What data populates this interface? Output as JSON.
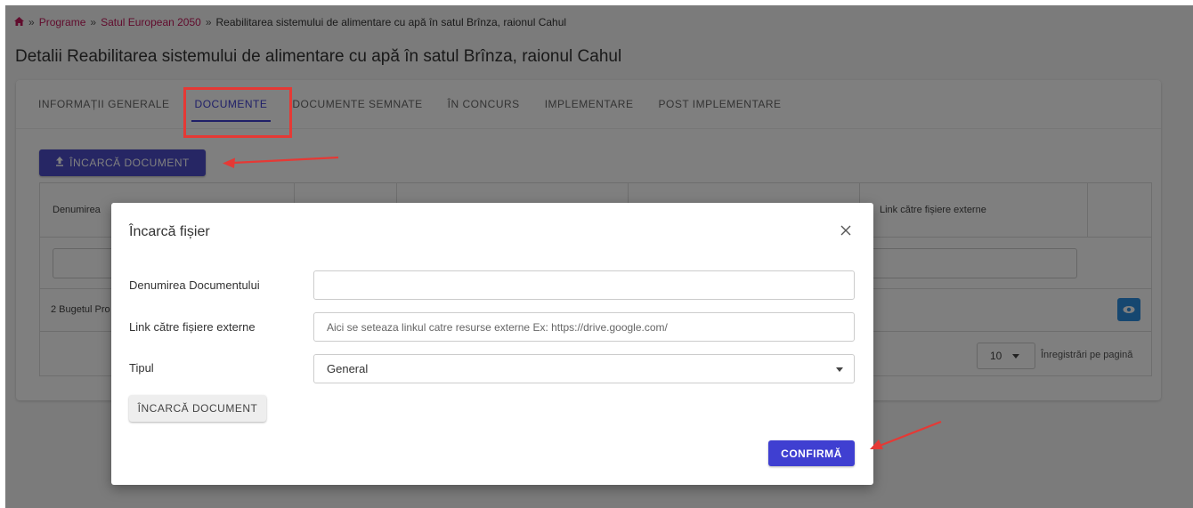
{
  "breadcrumb": {
    "separator": "»",
    "items": [
      "Programe",
      "Satul European 2050"
    ],
    "current": "Reabilitarea sistemului de alimentare cu apă în satul Brînza, raionul Cahul"
  },
  "page_title": "Detalii Reabilitarea sistemului de alimentare cu apă în satul Brînza, raionul Cahul",
  "tabs": [
    {
      "label": "INFORMAȚII GENERALE",
      "active": false
    },
    {
      "label": "DOCUMENTE",
      "active": true
    },
    {
      "label": "DOCUMENTE SEMNATE",
      "active": false
    },
    {
      "label": "ÎN CONCURS",
      "active": false
    },
    {
      "label": "IMPLEMENTARE",
      "active": false
    },
    {
      "label": "POST IMPLEMENTARE",
      "active": false
    }
  ],
  "upload_button": {
    "label": "ÎNCARCĂ DOCUMENT",
    "icon": "upload-icon"
  },
  "table": {
    "columns": [
      "Denumirea",
      "",
      "",
      "",
      "Link către fișiere externe",
      ""
    ],
    "row_text": "2 Bugetul Pro"
  },
  "pagination": {
    "per_page": "10",
    "label": "Înregistrări pe pagină"
  },
  "modal": {
    "title": "Încarcă fișier",
    "fields": {
      "name": {
        "label": "Denumirea Documentului",
        "value": "",
        "placeholder": ""
      },
      "link": {
        "label": "Link către fișiere externe",
        "value": "",
        "placeholder": "Aici se seteaza linkul catre resurse externe Ex: https://drive.google.com/"
      },
      "type": {
        "label": "Tipul",
        "selected": "General"
      }
    },
    "upload_label": "ÎNCARCĂ DOCUMENT",
    "confirm_label": "CONFIRMĂ"
  },
  "colors": {
    "accent": "#3f3fd1",
    "link": "#c2185b",
    "annotation": "#e53935"
  }
}
